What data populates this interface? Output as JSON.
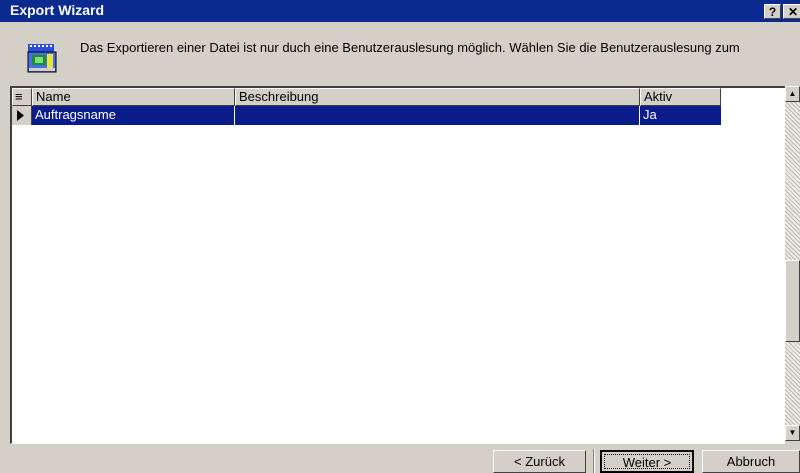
{
  "window": {
    "title": "Export Wizard",
    "help_glyph": "?",
    "close_glyph": "✕"
  },
  "info": {
    "icon": "export-wizard-icon",
    "text": "Das Exportieren einer Datei ist nur duch eine Benutzerauslesung möglich. Wählen Sie die Benutzerauslesung zum"
  },
  "grid": {
    "corner_glyph": "≡",
    "columns": [
      {
        "label": "Name"
      },
      {
        "label": "Beschreibung"
      },
      {
        "label": "Aktiv"
      }
    ],
    "rows": [
      {
        "name": "Auftragsname",
        "beschreibung": "",
        "aktiv": "Ja",
        "selected": true
      }
    ],
    "row_indicator": "▶"
  },
  "scrollbar": {
    "up_glyph": "▲",
    "down_glyph": "▼"
  },
  "buttons": {
    "back": "< Zurück",
    "next": "Weiter >",
    "cancel": "Abbruch"
  },
  "colors": {
    "title_bar": "#0a2a8f",
    "selection": "#0a1b8a",
    "face": "#d4d0c8"
  }
}
